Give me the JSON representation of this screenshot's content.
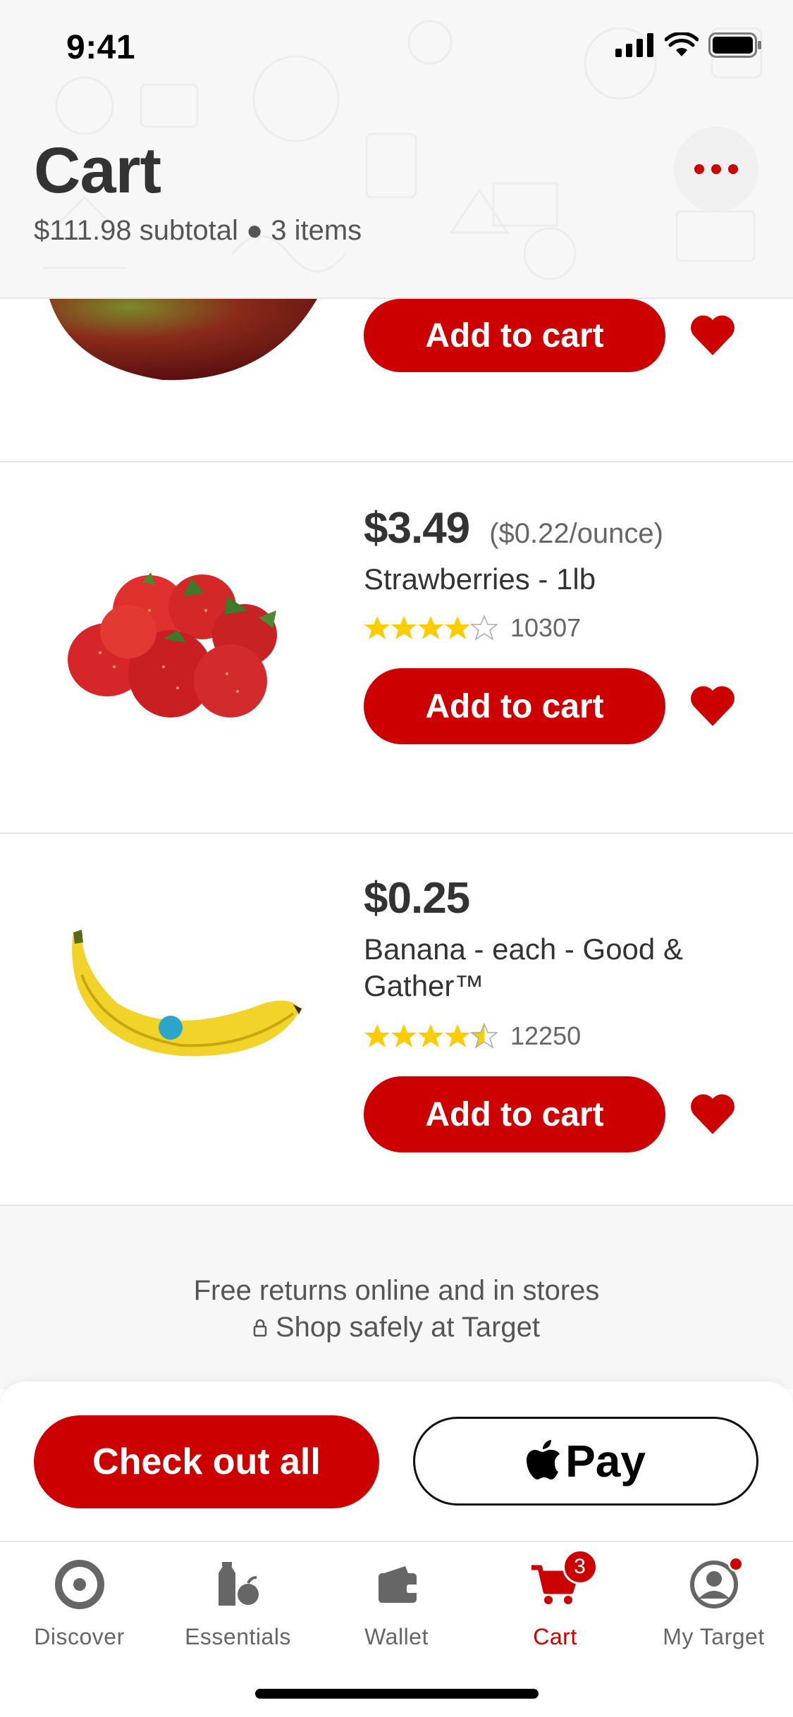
{
  "status_bar": {
    "time": "9:41"
  },
  "header": {
    "title": "Cart",
    "subtitle": "$111.98 subtotal ● 3 items",
    "more_icon": "more-dots-icon"
  },
  "products": [
    {
      "name": "",
      "price": "",
      "add_label": "Add to cart",
      "image": "mango-image"
    },
    {
      "price": "$3.49",
      "unit_price": "($0.22/ounce)",
      "name": "Strawberries - 1lb",
      "rating": 4.0,
      "rating_count": "10307",
      "add_label": "Add to cart",
      "image": "strawberries-image"
    },
    {
      "price": "$0.25",
      "name": "Banana - each - Good & Gather™",
      "rating": 4.5,
      "rating_count": "12250",
      "add_label": "Add to cart",
      "image": "banana-image"
    }
  ],
  "info": {
    "line1": "Free returns online and in stores",
    "line2": "Shop safely at Target"
  },
  "checkout": {
    "checkout_label": "Check out all",
    "applepay_label": "Pay"
  },
  "tabs": [
    {
      "label": "Discover",
      "icon": "target-bullseye-icon"
    },
    {
      "label": "Essentials",
      "icon": "essentials-icon"
    },
    {
      "label": "Wallet",
      "icon": "wallet-icon"
    },
    {
      "label": "Cart",
      "icon": "cart-icon",
      "badge": "3",
      "active": true
    },
    {
      "label": "My Target",
      "icon": "account-icon"
    }
  ],
  "colors": {
    "brand_red": "#cc0000",
    "star": "#ffcc00",
    "text": "#333333"
  }
}
